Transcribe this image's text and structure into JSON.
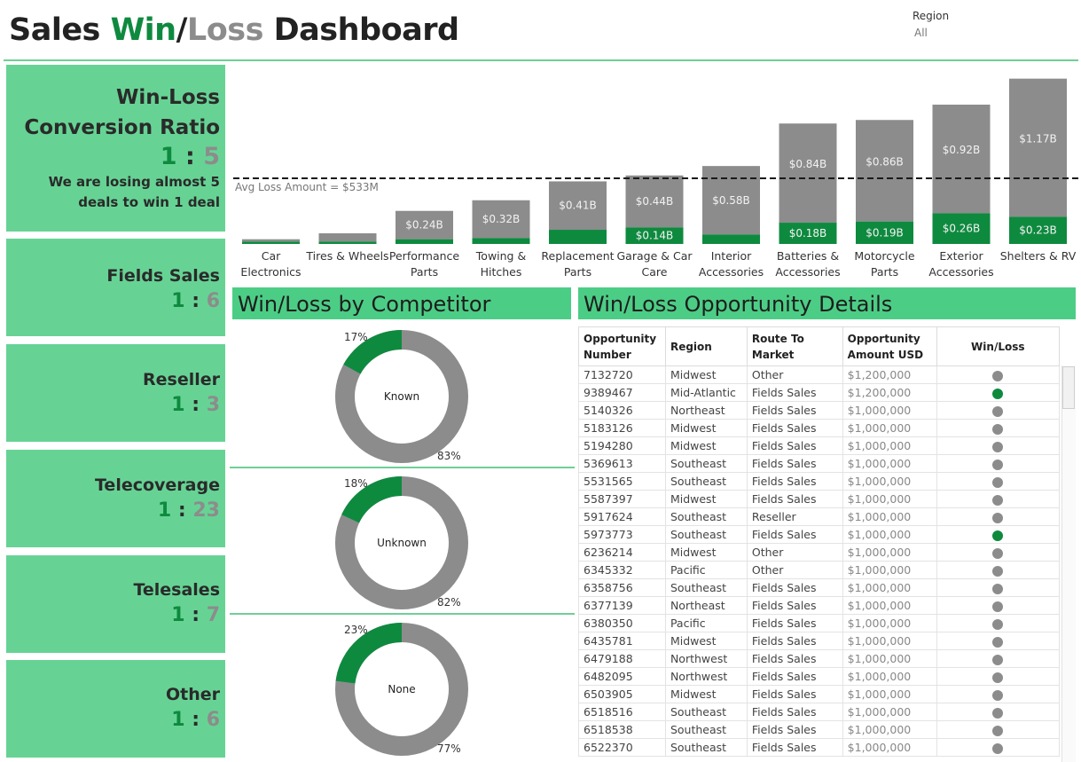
{
  "header": {
    "title_part1": "Sales ",
    "title_win": "Win",
    "title_slash": "/",
    "title_loss": "Loss",
    "title_part2": " Dashboard",
    "region_label": "Region",
    "region_value": "All"
  },
  "colors": {
    "win": "#0e8a3f",
    "loss": "#8c8c8c",
    "panel": "#66d394",
    "header": "#4ccd85"
  },
  "kpis": {
    "main": {
      "title": "Win-Loss Conversion Ratio",
      "win": "1",
      "sep": ":",
      "loss": "5",
      "note": "We are losing almost 5 deals to win 1 deal"
    },
    "fields_sales": {
      "title": "Fields Sales",
      "win": "1",
      "sep": ":",
      "loss": "6"
    },
    "reseller": {
      "title": "Reseller",
      "win": "1",
      "sep": ":",
      "loss": "3"
    },
    "telecoverage": {
      "title": "Telecoverage",
      "win": "1",
      "sep": ":",
      "loss": "23"
    },
    "telesales": {
      "title": "Telesales",
      "win": "1",
      "sep": ":",
      "loss": "7"
    },
    "other": {
      "title": "Other",
      "win": "1",
      "sep": ":",
      "loss": "6"
    }
  },
  "chart_data": {
    "type": "bar",
    "stacked": true,
    "categories": [
      "Car Electronics",
      "Tires & Wheels",
      "Performance Parts",
      "Towing & Hitches",
      "Replacement Parts",
      "Garage & Car Care",
      "Interior Accessories",
      "Batteries & Accessories",
      "Motorcycle Parts",
      "Exterior Accessories",
      "Shelters & RV"
    ],
    "category_lines": [
      [
        "Car",
        "Electronics"
      ],
      [
        "Tires & Wheels"
      ],
      [
        "Performance",
        "Parts"
      ],
      [
        "Towing &",
        "Hitches"
      ],
      [
        "Replacement",
        "Parts"
      ],
      [
        "Garage & Car",
        "Care"
      ],
      [
        "Interior",
        "Accessories"
      ],
      [
        "Batteries &",
        "Accessories"
      ],
      [
        "Motorcycle",
        "Parts"
      ],
      [
        "Exterior",
        "Accessories"
      ],
      [
        "Shelters & RV"
      ]
    ],
    "series": [
      {
        "values": [
          0.02,
          0.02,
          0.04,
          0.05,
          0.12,
          0.14,
          0.08,
          0.18,
          0.19,
          0.26,
          0.23
        ],
        "labels": [
          "",
          "",
          "",
          "",
          "",
          "$0.14B",
          "",
          "$0.18B",
          "$0.19B",
          "$0.26B",
          "$0.23B"
        ]
      },
      {
        "values": [
          0.02,
          0.07,
          0.24,
          0.32,
          0.41,
          0.44,
          0.58,
          0.84,
          0.86,
          0.92,
          1.17
        ],
        "labels": [
          "",
          "",
          "$0.24B",
          "$0.32B",
          "$0.41B",
          "$0.44B",
          "$0.58B",
          "$0.84B",
          "$0.86B",
          "$0.92B",
          "$1.17B"
        ]
      }
    ],
    "avg_line": {
      "value": 0.533,
      "label": "Avg Loss Amount = $533M"
    },
    "ylim": [
      0,
      1.45
    ]
  },
  "competitor": {
    "title": "Win/Loss by Competitor",
    "donuts": [
      {
        "label": "Known",
        "win_pct": 17,
        "loss_pct": 83,
        "win_text": "17%",
        "loss_text": "83%"
      },
      {
        "label": "Unknown",
        "win_pct": 18,
        "loss_pct": 82,
        "win_text": "18%",
        "loss_text": "82%"
      },
      {
        "label": "None",
        "win_pct": 23,
        "loss_pct": 77,
        "win_text": "23%",
        "loss_text": "77%"
      }
    ]
  },
  "details": {
    "title": "Win/Loss Opportunity Details",
    "columns": [
      "Opportunity Number",
      "Region",
      "Route To Market",
      "Opportunity Amount USD",
      "Win/Loss"
    ],
    "rows": [
      [
        "7132720",
        "Midwest",
        "Other",
        "$1,200,000",
        "loss"
      ],
      [
        "9389467",
        "Mid-Atlantic",
        "Fields Sales",
        "$1,200,000",
        "won"
      ],
      [
        "5140326",
        "Northeast",
        "Fields Sales",
        "$1,000,000",
        "loss"
      ],
      [
        "5183126",
        "Midwest",
        "Fields Sales",
        "$1,000,000",
        "loss"
      ],
      [
        "5194280",
        "Midwest",
        "Fields Sales",
        "$1,000,000",
        "loss"
      ],
      [
        "5369613",
        "Southeast",
        "Fields Sales",
        "$1,000,000",
        "loss"
      ],
      [
        "5531565",
        "Southeast",
        "Fields Sales",
        "$1,000,000",
        "loss"
      ],
      [
        "5587397",
        "Midwest",
        "Fields Sales",
        "$1,000,000",
        "loss"
      ],
      [
        "5917624",
        "Southeast",
        "Reseller",
        "$1,000,000",
        "loss"
      ],
      [
        "5973773",
        "Southeast",
        "Fields Sales",
        "$1,000,000",
        "won"
      ],
      [
        "6236214",
        "Midwest",
        "Other",
        "$1,000,000",
        "loss"
      ],
      [
        "6345332",
        "Pacific",
        "Other",
        "$1,000,000",
        "loss"
      ],
      [
        "6358756",
        "Southeast",
        "Fields Sales",
        "$1,000,000",
        "loss"
      ],
      [
        "6377139",
        "Northeast",
        "Fields Sales",
        "$1,000,000",
        "loss"
      ],
      [
        "6380350",
        "Pacific",
        "Fields Sales",
        "$1,000,000",
        "loss"
      ],
      [
        "6435781",
        "Midwest",
        "Fields Sales",
        "$1,000,000",
        "loss"
      ],
      [
        "6479188",
        "Northwest",
        "Fields Sales",
        "$1,000,000",
        "loss"
      ],
      [
        "6482095",
        "Northwest",
        "Fields Sales",
        "$1,000,000",
        "loss"
      ],
      [
        "6503905",
        "Midwest",
        "Fields Sales",
        "$1,000,000",
        "loss"
      ],
      [
        "6518516",
        "Southeast",
        "Fields Sales",
        "$1,000,000",
        "loss"
      ],
      [
        "6518538",
        "Southeast",
        "Fields Sales",
        "$1,000,000",
        "loss"
      ],
      [
        "6522370",
        "Southeast",
        "Fields Sales",
        "$1,000,000",
        "loss"
      ]
    ]
  }
}
